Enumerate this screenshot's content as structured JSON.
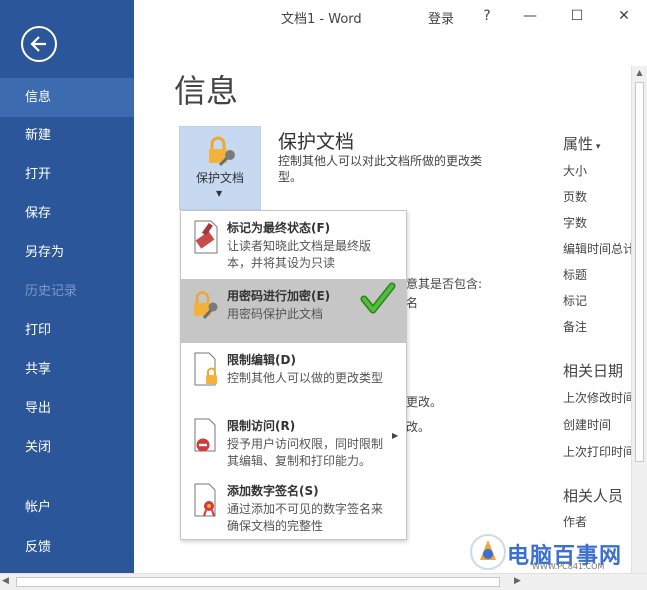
{
  "window": {
    "title": "文档1  -  Word",
    "login": "登录",
    "help": "?",
    "minimize": "—",
    "restore": "☐",
    "close": "✕"
  },
  "sidebar": {
    "items": [
      {
        "label": "信息"
      },
      {
        "label": "新建"
      },
      {
        "label": "打开"
      },
      {
        "label": "保存"
      },
      {
        "label": "另存为"
      },
      {
        "label": "历史记录"
      },
      {
        "label": "打印"
      },
      {
        "label": "共享"
      },
      {
        "label": "导出"
      },
      {
        "label": "关闭"
      },
      {
        "label": "帐户"
      },
      {
        "label": "反馈"
      }
    ]
  },
  "main": {
    "page_title": "信息",
    "protect_button_label": "保护文档",
    "protect_title": "保护文档",
    "protect_desc": "控制其他人可以对此文档所做的更改类型。",
    "bg_lines": [
      "意其是否包含:",
      "名",
      "更改。",
      "改。"
    ]
  },
  "menu": {
    "items": [
      {
        "title": "标记为最终状态(F)",
        "desc": "让读者知晓此文档是最终版本，并将其设为只读"
      },
      {
        "title": "用密码进行加密(E)",
        "desc": "用密码保护此文档"
      },
      {
        "title": "限制编辑(D)",
        "desc": "控制其他人可以做的更改类型"
      },
      {
        "title": "限制访问(R)",
        "desc": "授予用户访问权限，同时限制其编辑、复制和打印能力。"
      },
      {
        "title": "添加数字签名(S)",
        "desc": "通过添加不可见的数字签名来确保文档的完整性"
      }
    ]
  },
  "properties": {
    "header": "属性",
    "rows": [
      "大小",
      "页数",
      "字数",
      "编辑时间总计",
      "标题",
      "标记",
      "备注"
    ],
    "dates_header": "相关日期",
    "dates": [
      "上次修改时间",
      "创建时间",
      "上次打印时间"
    ],
    "people_header": "相关人员",
    "people": [
      "作者"
    ]
  },
  "watermark": {
    "text": "电脑百事网",
    "sub": "WWW.PC841.COM"
  },
  "colors": {
    "sidebar": "#2b579a",
    "sidebar_active": "#3d6bb0",
    "protect_button": "#c7d9f0",
    "menu_highlight": "#c6c6c6",
    "check": "#3da02b"
  }
}
